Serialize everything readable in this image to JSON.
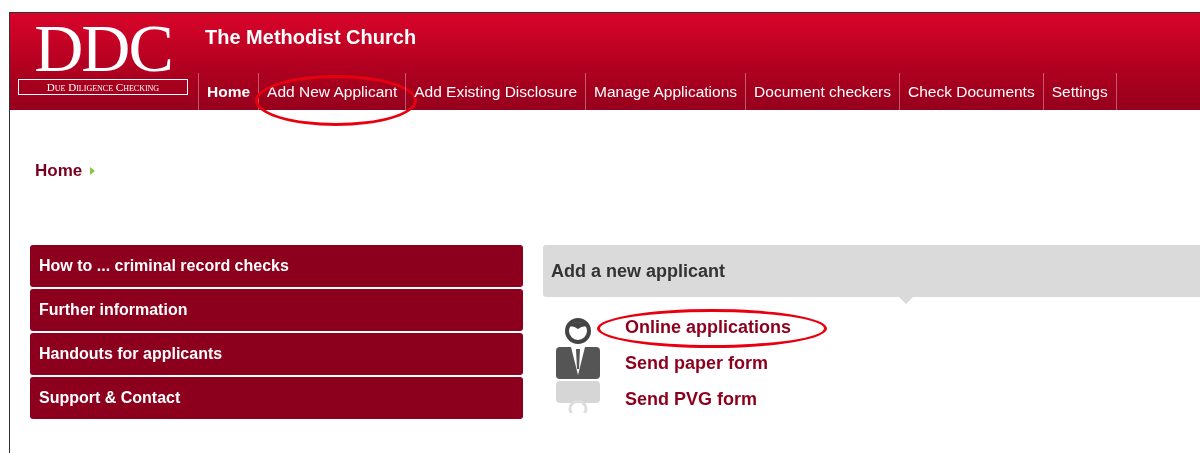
{
  "logo": {
    "mark": "DDC",
    "tagline": "Due Diligence Checking"
  },
  "header": {
    "title": "The Methodist Church"
  },
  "nav": [
    {
      "label": "Home",
      "selected": true,
      "circled": false
    },
    {
      "label": "Add New Applicant",
      "selected": false,
      "circled": true
    },
    {
      "label": "Add Existing Disclosure",
      "selected": false,
      "circled": false
    },
    {
      "label": "Manage Applications",
      "selected": false,
      "circled": false
    },
    {
      "label": "Document checkers",
      "selected": false,
      "circled": false
    },
    {
      "label": "Check Documents",
      "selected": false,
      "circled": false
    },
    {
      "label": "Settings",
      "selected": false,
      "circled": false
    }
  ],
  "breadcrumb": [
    "Home"
  ],
  "sidebar": {
    "items": [
      "How to ... criminal record checks",
      "Further information",
      "Handouts for applicants",
      "Support & Contact"
    ]
  },
  "panel": {
    "title": "Add a new applicant",
    "links": [
      {
        "label": "Online applications",
        "circled": true
      },
      {
        "label": "Send paper form",
        "circled": false
      },
      {
        "label": "Send PVG form",
        "circled": false
      }
    ]
  }
}
